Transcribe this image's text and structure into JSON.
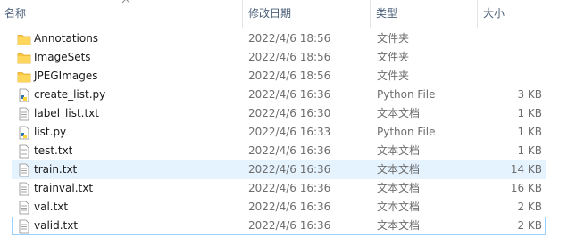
{
  "columns": {
    "name": "名称",
    "date": "修改日期",
    "type": "类型",
    "size": "大小"
  },
  "files": [
    {
      "name": "Annotations",
      "date": "2022/4/6 18:56",
      "type": "文件夹",
      "size": "",
      "icon": "folder-icon"
    },
    {
      "name": "ImageSets",
      "date": "2022/4/6 18:56",
      "type": "文件夹",
      "size": "",
      "icon": "folder-icon"
    },
    {
      "name": "JPEGImages",
      "date": "2022/4/6 18:56",
      "type": "文件夹",
      "size": "",
      "icon": "folder-icon"
    },
    {
      "name": "create_list.py",
      "date": "2022/4/6 16:36",
      "type": "Python File",
      "size": "3 KB",
      "icon": "python-file-icon"
    },
    {
      "name": "label_list.txt",
      "date": "2022/4/6 16:30",
      "type": "文本文档",
      "size": "1 KB",
      "icon": "text-file-icon"
    },
    {
      "name": "list.py",
      "date": "2022/4/6 16:33",
      "type": "Python File",
      "size": "1 KB",
      "icon": "python-file-icon"
    },
    {
      "name": "test.txt",
      "date": "2022/4/6 16:36",
      "type": "文本文档",
      "size": "1 KB",
      "icon": "text-file-icon"
    },
    {
      "name": "train.txt",
      "date": "2022/4/6 16:36",
      "type": "文本文档",
      "size": "14 KB",
      "icon": "text-file-icon"
    },
    {
      "name": "trainval.txt",
      "date": "2022/4/6 16:36",
      "type": "文本文档",
      "size": "16 KB",
      "icon": "text-file-icon"
    },
    {
      "name": "val.txt",
      "date": "2022/4/6 16:36",
      "type": "文本文档",
      "size": "2 KB",
      "icon": "text-file-icon"
    },
    {
      "name": "valid.txt",
      "date": "2022/4/6 16:36",
      "type": "文本文档",
      "size": "2 KB",
      "icon": "text-file-icon"
    }
  ],
  "colors": {
    "header_text": "#4c607a",
    "hover_row": "#e5f3ff",
    "focus_border": "#99d1ff",
    "folder": "#ffc83d"
  }
}
